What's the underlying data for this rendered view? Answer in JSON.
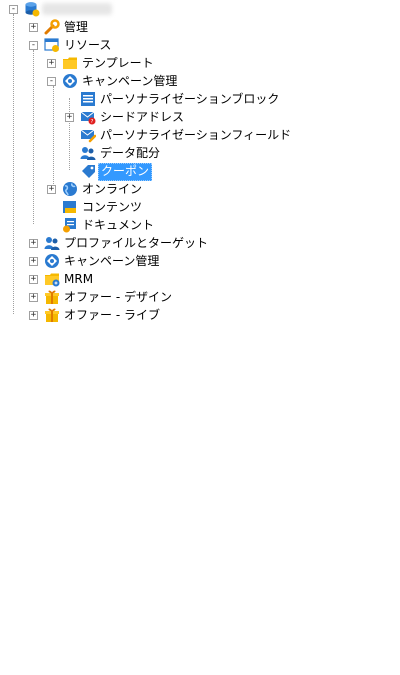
{
  "tree": {
    "root": {
      "label": "",
      "icon": "database-icon",
      "expanded": true
    },
    "items": [
      {
        "label": "管理",
        "icon": "wrench-icon",
        "expander": "+"
      },
      {
        "label": "リソース",
        "icon": "resources-folder-icon",
        "expander": "-"
      },
      {
        "label": "テンプレート",
        "icon": "folder-icon",
        "expander": "+"
      },
      {
        "label": "キャンペーン管理",
        "icon": "campaign-icon",
        "expander": "-"
      },
      {
        "label": "パーソナライゼーションブロック",
        "icon": "personalization-block-icon"
      },
      {
        "label": "シードアドレス",
        "icon": "seed-address-icon",
        "expander": "+"
      },
      {
        "label": "パーソナライゼーションフィールド",
        "icon": "personalization-field-icon"
      },
      {
        "label": "データ配分",
        "icon": "data-distribution-icon"
      },
      {
        "label": "クーポン",
        "icon": "coupon-icon",
        "selected": true
      },
      {
        "label": "オンライン",
        "icon": "globe-icon",
        "expander": "+"
      },
      {
        "label": "コンテンツ",
        "icon": "content-folder-icon"
      },
      {
        "label": "ドキュメント",
        "icon": "document-icon"
      },
      {
        "label": "プロファイルとターゲット",
        "icon": "profiles-icon",
        "expander": "+"
      },
      {
        "label": "キャンペーン管理",
        "icon": "campaign-icon",
        "expander": "+"
      },
      {
        "label": "MRM",
        "icon": "mrm-folder-icon",
        "expander": "+"
      },
      {
        "label": "オファー - デザイン",
        "icon": "offer-gift-icon",
        "expander": "+"
      },
      {
        "label": "オファー - ライブ",
        "icon": "offer-gift-icon",
        "expander": "+"
      }
    ]
  },
  "colors": {
    "selection": "#3399ff",
    "folder": "#f5b800",
    "blue": "#2a7ad0"
  }
}
